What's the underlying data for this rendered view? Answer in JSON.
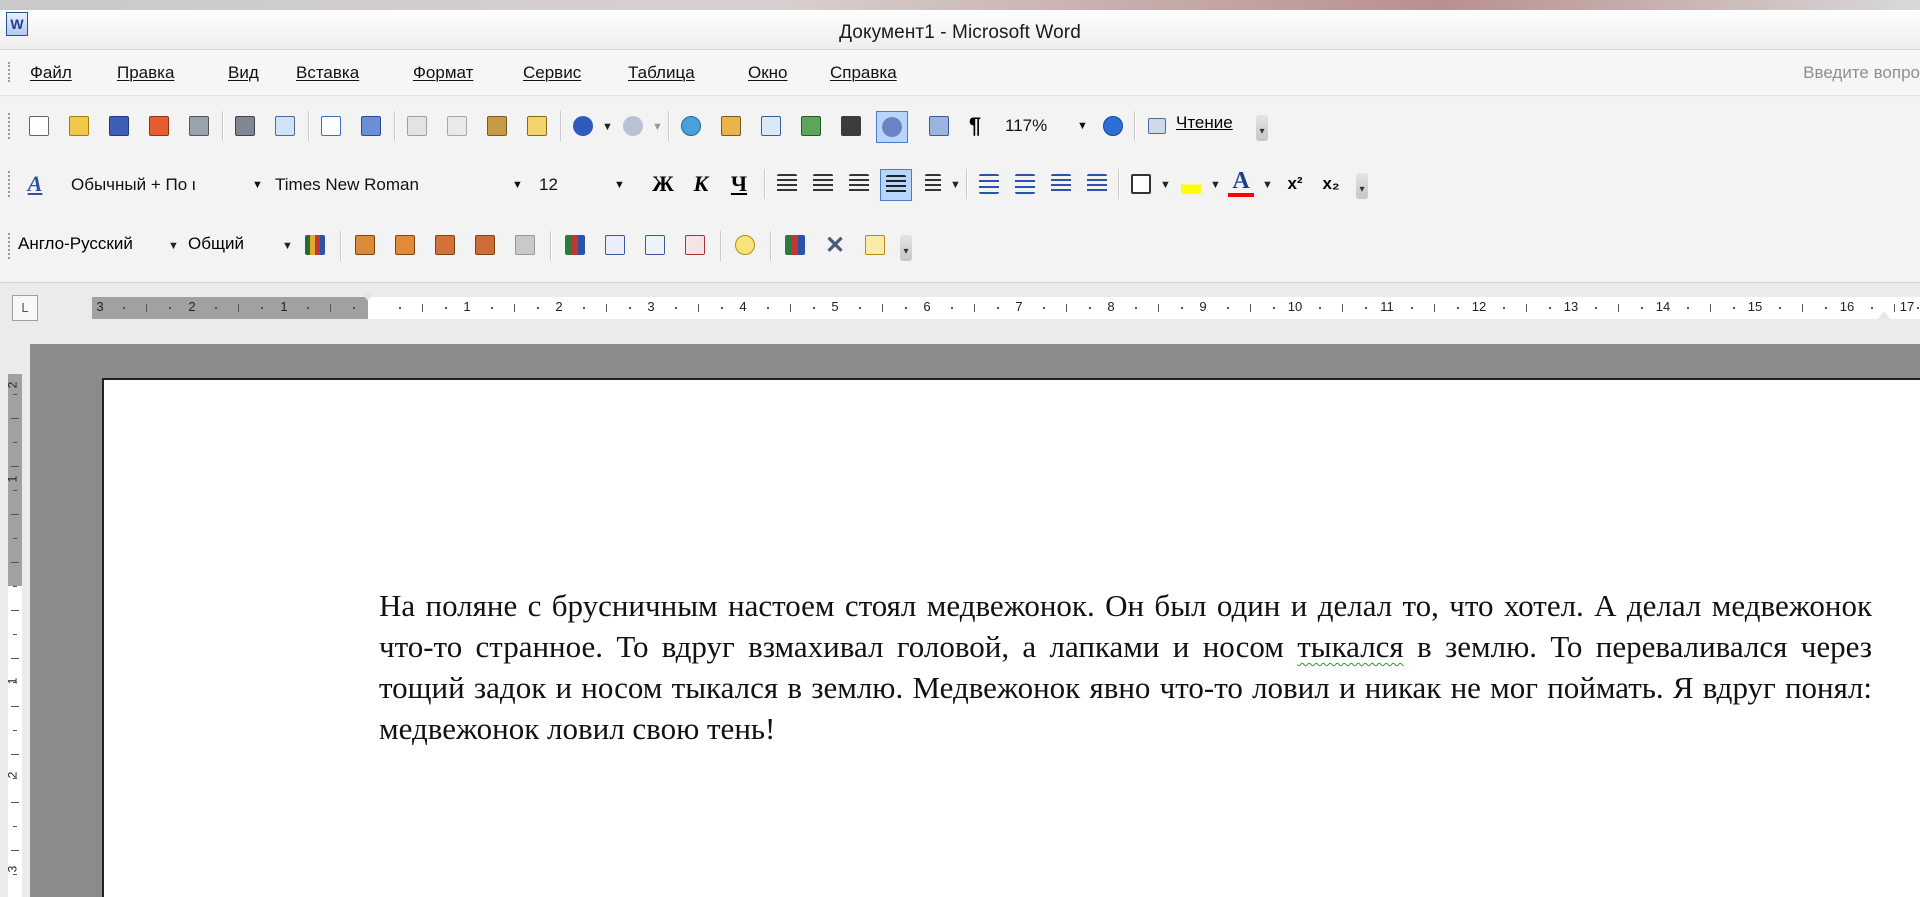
{
  "window": {
    "title": "Документ1 - Microsoft Word",
    "app_icon": "W"
  },
  "menu": {
    "items": [
      "Файл",
      "Правка",
      "Вид",
      "Вставка",
      "Формат",
      "Сервис",
      "Таблица",
      "Окно",
      "Справка"
    ],
    "help_placeholder": "Введите вопро"
  },
  "standard_toolbar": {
    "zoom": "117%",
    "reading_label": "Чтение",
    "icons": [
      "new-document-icon",
      "open-icon",
      "save-icon",
      "permission-icon",
      "print-icon",
      "print-preview-icon",
      "spelling-icon",
      "research-icon",
      "cut-icon",
      "copy-icon",
      "paste-icon",
      "format-painter-icon",
      "undo-icon",
      "redo-icon",
      "hyperlink-icon",
      "tables-borders-icon",
      "insert-table-icon",
      "insert-excel-icon",
      "columns-icon",
      "drawing-icon",
      "document-map-icon",
      "show-hide-icon",
      "help-icon"
    ]
  },
  "formatting_toolbar": {
    "style": "Обычный + По ι",
    "font": "Times New Roman",
    "size": "12",
    "bold": "Ж",
    "italic": "К",
    "underline": "Ч",
    "font_color_letter": "A",
    "superscript": "x²",
    "subscript": "x₂"
  },
  "dictionary_toolbar": {
    "language": "Англо-Русский",
    "mode": "Общий"
  },
  "ruler": {
    "numbers_left": [
      "3",
      "2",
      "1"
    ],
    "numbers_right": [
      "1",
      "2",
      "3",
      "4",
      "5",
      "6",
      "7",
      "8",
      "9",
      "10",
      "11",
      "12",
      "13",
      "14",
      "15",
      "16",
      "17"
    ]
  },
  "vertical_ruler": {
    "numbers": [
      "2",
      "1",
      "1",
      "2",
      "3"
    ]
  },
  "document": {
    "text_before": "На поляне с брусничным настоем стоял медвежонок. Он был один и делал то, что хотел. А делал медвежонок что-то странное. То вдруг взмахивал головой, а лапками и носом ",
    "spell_word": "тыкался",
    "text_after": " в землю. То переваливался через тощий задок и носом тыкался в землю. Медвежонок явно что-то ловил и никак не мог поймать. Я вдруг понял: медвежонок ловил свою тень!"
  },
  "colors": {
    "highlight": "#ffff00",
    "font_color": "#ff0000",
    "active_button": "#b8d6fb"
  }
}
